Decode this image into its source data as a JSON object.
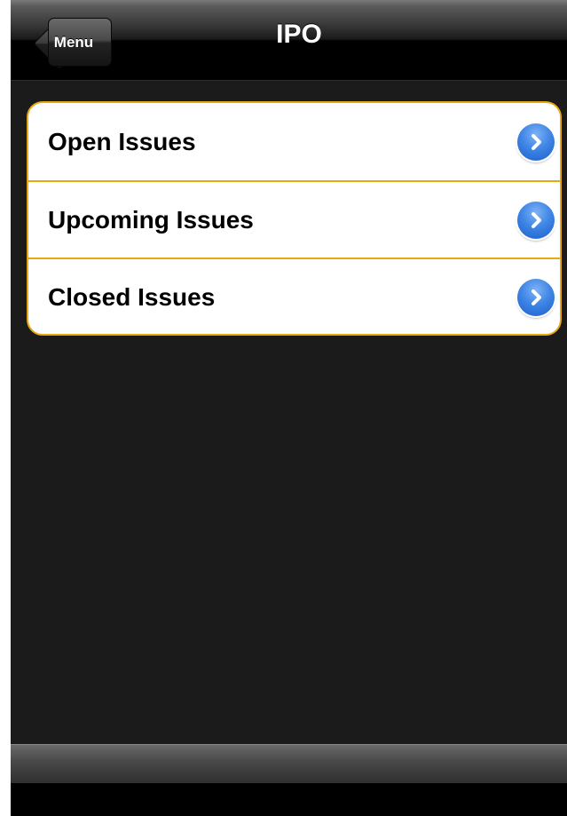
{
  "navbar": {
    "back_label": "Menu",
    "title": "IPO"
  },
  "list": {
    "items": [
      {
        "label": "Open Issues"
      },
      {
        "label": "Upcoming Issues"
      },
      {
        "label": "Closed Issues"
      }
    ]
  },
  "icons": {
    "disclosure": "chevron-right-circle-icon",
    "back": "back-arrow-icon"
  },
  "colors": {
    "accent_border": "#e8a812",
    "disclosure_blue": "#3f86e6",
    "background": "#1b1b1b"
  }
}
